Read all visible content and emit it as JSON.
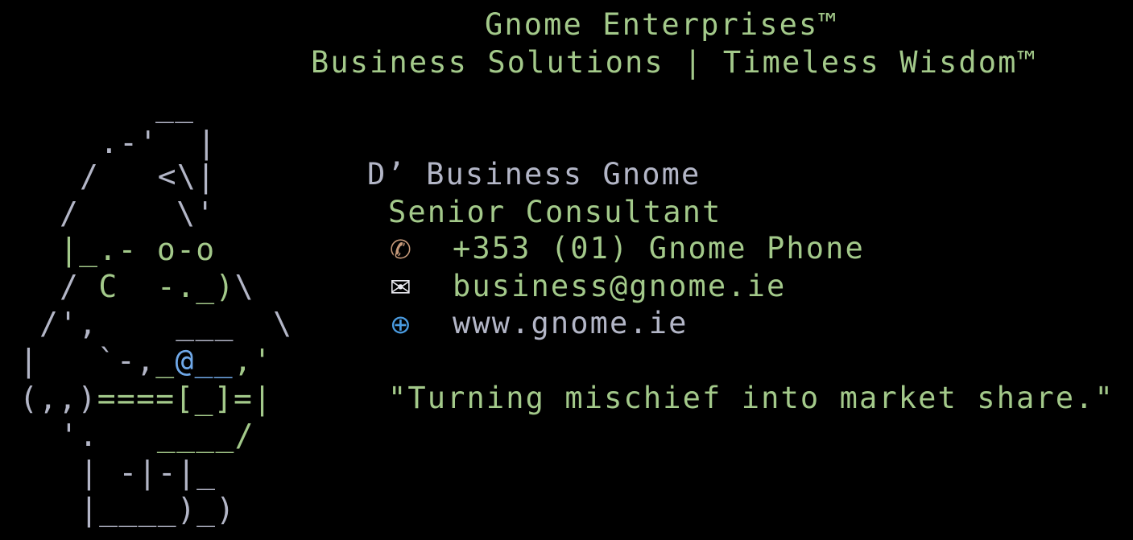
{
  "header": {
    "company": "Gnome Enterprises™",
    "tagline": "Business Solutions | Timeless Wisdom™"
  },
  "ascii_art": {
    "l1": "__",
    "l2": ".-'  |",
    "l3": "/   <\\|",
    "l4": "/     \\'",
    "l5": "|_.- o-o",
    "l6_gray_a": "/",
    "l6_green": "C  -._)",
    "l6_gray_b": "\\",
    "l7_gray_a": "/',",
    "l7_green": "___",
    "l7_gray_b": "\\",
    "l8_gray_a": "|   `-,",
    "l8_green_a": "_",
    "l8_at": "@",
    "l8_blue": "__",
    "l8_gray_b": ",'",
    "l9_gray_a": "(,,)",
    "l9_green": "====[_]=",
    "l9_gray_b": "|",
    "l10_gray": "'.",
    "l10_green": "____/",
    "l11": "| -|-|_",
    "l12": "|____)_)"
  },
  "card": {
    "name": "D’ Business Gnome",
    "title": "Senior Consultant",
    "phone": "+353 (01) Gnome Phone",
    "email": "business@gnome.ie",
    "website": "www.gnome.ie",
    "quote": "\"Turning mischief into market share.\""
  },
  "icons": {
    "phone": "telephone-icon",
    "email": "envelope-icon",
    "website": "globe-icon"
  },
  "colors": {
    "background": "#000000",
    "green_text": "#a3c98a",
    "gray_text": "#b3b6c7",
    "blue_accent": "#6fa8e8"
  }
}
